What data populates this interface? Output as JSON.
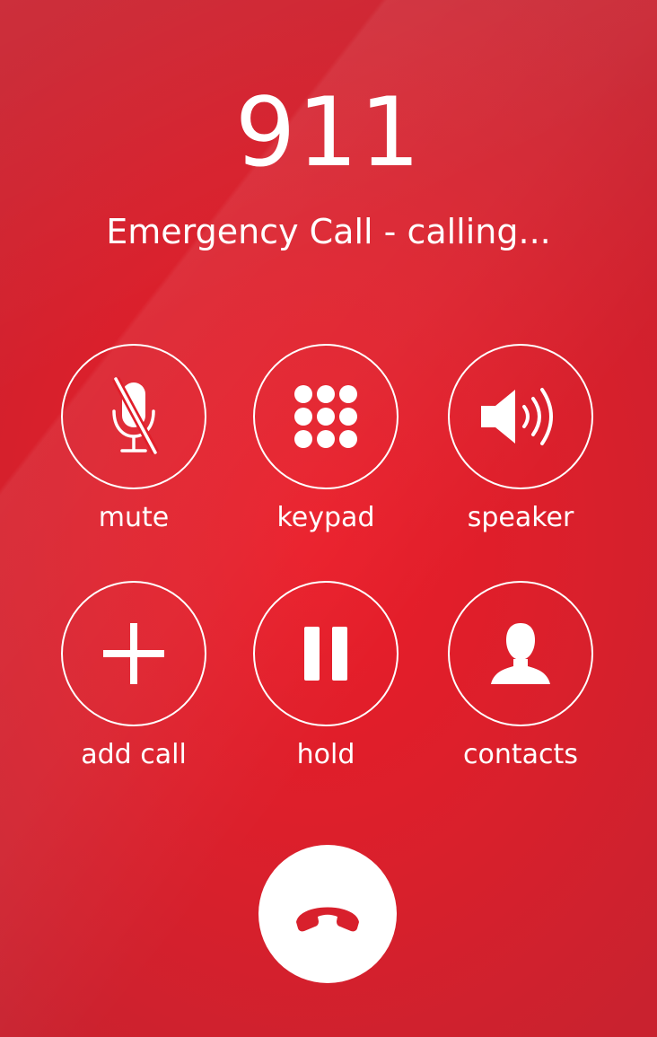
{
  "call": {
    "number": "911",
    "status": "Emergency Call - calling..."
  },
  "controls": [
    {
      "label": "mute",
      "icon": "microphone-off-icon"
    },
    {
      "label": "keypad",
      "icon": "keypad-icon"
    },
    {
      "label": "speaker",
      "icon": "speaker-icon"
    },
    {
      "label": "add call",
      "icon": "plus-icon"
    },
    {
      "label": "hold",
      "icon": "pause-icon"
    },
    {
      "label": "contacts",
      "icon": "person-icon"
    }
  ],
  "end_call": {
    "icon": "hang-up-phone-icon"
  },
  "colors": {
    "background": "#e01e2a",
    "foreground": "#ffffff",
    "end_call_icon": "#d8202c"
  }
}
